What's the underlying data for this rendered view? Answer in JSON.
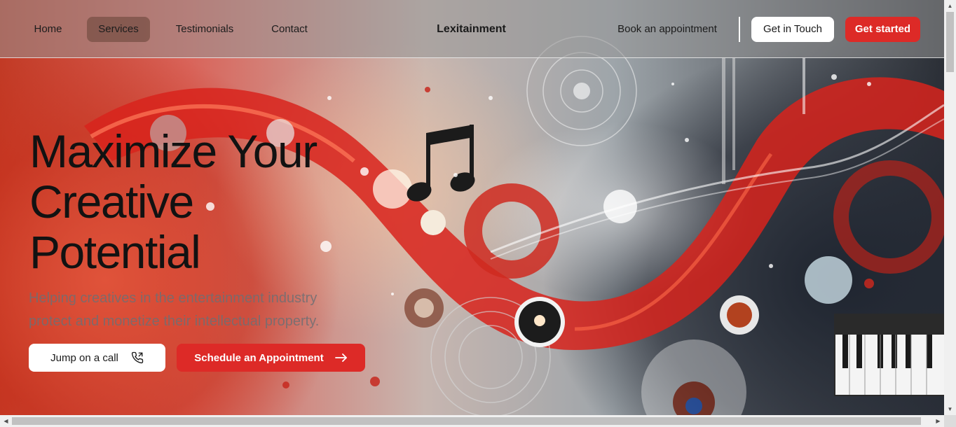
{
  "nav": {
    "links": [
      {
        "label": "Home",
        "active": false
      },
      {
        "label": "Services",
        "active": true
      },
      {
        "label": "Testimonials",
        "active": false
      },
      {
        "label": "Contact",
        "active": false
      }
    ],
    "brand": "Lexitainment",
    "book_link": "Book an appointment",
    "get_in_touch": "Get in Touch",
    "get_started": "Get started"
  },
  "hero": {
    "headline_line1": "Maximize Your",
    "headline_line2": "Creative",
    "headline_line3": "Potential",
    "subtext": "Helping creatives in the entertainment industry protect and monetize their intellectual property.",
    "call_button": "Jump on a call",
    "schedule_button": "Schedule an Appointment",
    "call_icon": "phone-icon",
    "schedule_icon": "arrow-right-icon"
  },
  "colors": {
    "accent": "#dd2a27",
    "text": "#121212"
  }
}
